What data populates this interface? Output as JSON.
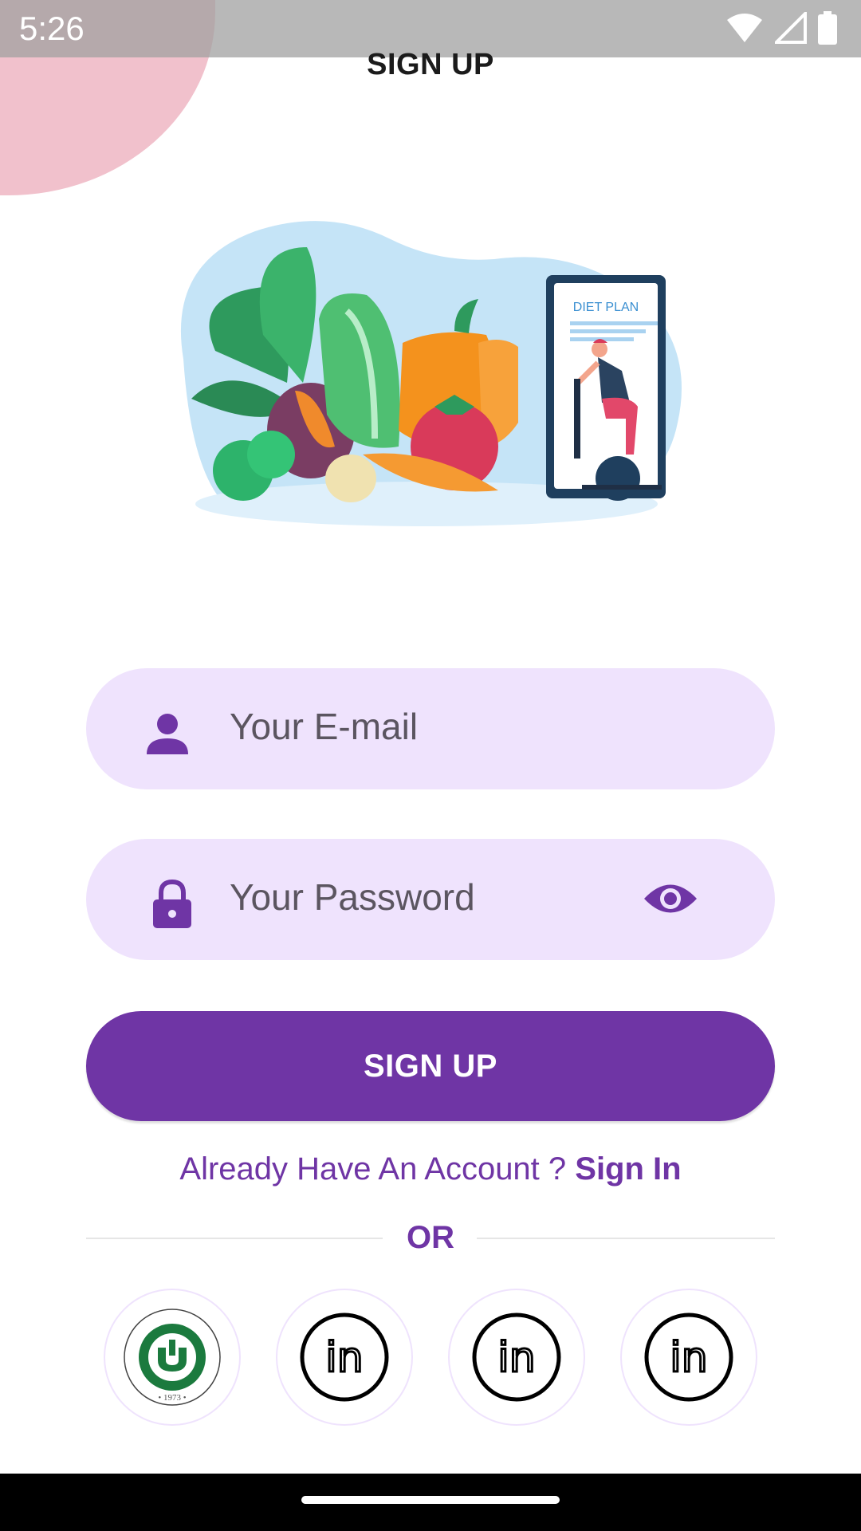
{
  "status_bar": {
    "time": "5:26",
    "icons": [
      "wifi-icon",
      "signal-icon",
      "battery-icon"
    ]
  },
  "page": {
    "title": "SIGN UP"
  },
  "hero": {
    "card_title": "DIET PLAN"
  },
  "email": {
    "placeholder": "Your E-mail",
    "icon": "person-icon"
  },
  "password": {
    "placeholder": "Your Password",
    "icon": "lock-icon",
    "toggle_icon": "eye-icon"
  },
  "signup_button": {
    "label": "SIGN UP"
  },
  "signin_prompt": {
    "text": "Already Have An Account ? ",
    "link": "Sign In"
  },
  "divider": {
    "label": "OR"
  },
  "social": {
    "university_seal": {
      "text_top": "ÇUKUROVA ÜNİVERSİTESİ",
      "year": "1973"
    },
    "buttons": [
      "university-logo",
      "linkedin-icon",
      "linkedin-icon",
      "linkedin-icon"
    ],
    "linkedin_label": "in"
  },
  "colors": {
    "accent": "#6f35a5",
    "field_bg": "#efe3fd",
    "blob": "#f1c1cc"
  }
}
